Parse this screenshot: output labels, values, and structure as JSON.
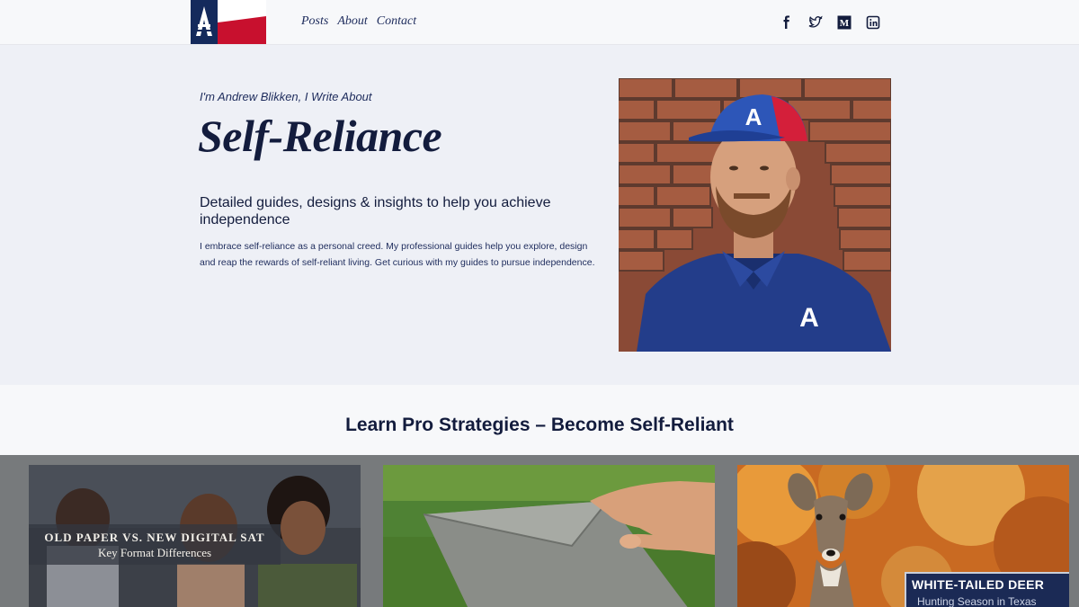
{
  "header": {
    "nav": [
      "Posts",
      "About",
      "Contact"
    ],
    "social": [
      {
        "icon": "facebook-icon"
      },
      {
        "icon": "twitter-icon"
      },
      {
        "icon": "medium-icon",
        "glyph": "M"
      },
      {
        "icon": "linkedin-icon"
      }
    ]
  },
  "hero": {
    "tagline": "I'm Andrew Blikken, I Write About",
    "headline": "Self-Reliance",
    "subhead": "Detailed guides, designs & insights to help you achieve independence",
    "description": "I embrace self-reliance as a personal creed. My professional guides help you explore, design and reap the rewards of self-reliant living. Get curious with my guides to pursue independence."
  },
  "strategies": {
    "title": "Learn Pro Strategies – Become Self-Reliant"
  },
  "cards": [
    {
      "title": "OLD PAPER VS. NEW DIGITAL SAT",
      "subtitle": "Key Format Differences"
    },
    {
      "title": "",
      "subtitle": ""
    },
    {
      "title": "WHITE-TAILED DEER",
      "subtitle": "Hunting Season in Texas"
    }
  ],
  "colors": {
    "navy": "#131c3d",
    "brand_red": "#c8102e",
    "background": "#eef0f6",
    "cards_bg": "#777a7c"
  }
}
